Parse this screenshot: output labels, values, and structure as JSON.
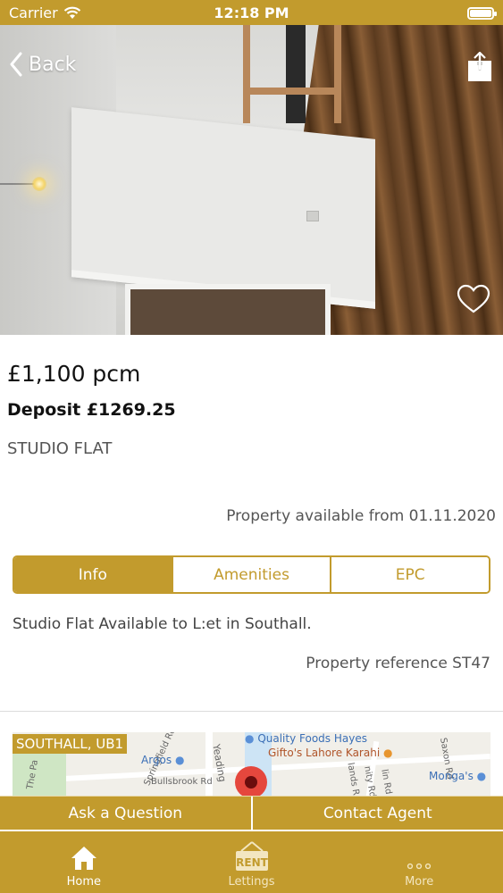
{
  "status_bar": {
    "carrier": "Carrier",
    "time": "12:18 PM"
  },
  "nav": {
    "back_label": "Back"
  },
  "listing": {
    "price": "£1,100 pcm",
    "deposit": "Deposit £1269.25",
    "property_type": "STUDIO FLAT",
    "available": "Property available from 01.11.2020",
    "description": "Studio Flat Available to L:et in Southall.",
    "reference": "Property reference ST47"
  },
  "tabs": [
    {
      "label": "Info",
      "active": true
    },
    {
      "label": "Amenities",
      "active": false
    },
    {
      "label": "EPC",
      "active": false
    }
  ],
  "map": {
    "area_label": "SOUTHALL, UB1",
    "pois": [
      "Quality Foods Hayes",
      "Gifto's Lahore Karahi",
      "Argos",
      "Monga's"
    ],
    "streets": [
      "Springfield Rd",
      "Yeading",
      "Bullsbrook Rd",
      "The Pa",
      "lands Rd",
      "nity Rd",
      "lin Rd",
      "Saxon Rd"
    ]
  },
  "actions": {
    "ask_label": "Ask a Question",
    "contact_label": "Contact Agent"
  },
  "tab_bar": [
    {
      "label": "Home",
      "icon": "home-icon",
      "active": true
    },
    {
      "label": "Lettings",
      "icon": "rent-sign-icon",
      "active": false
    },
    {
      "label": "More",
      "icon": "more-dots-icon",
      "active": false
    }
  ],
  "colors": {
    "accent": "#c29b2d",
    "pin": "#e5473d"
  }
}
